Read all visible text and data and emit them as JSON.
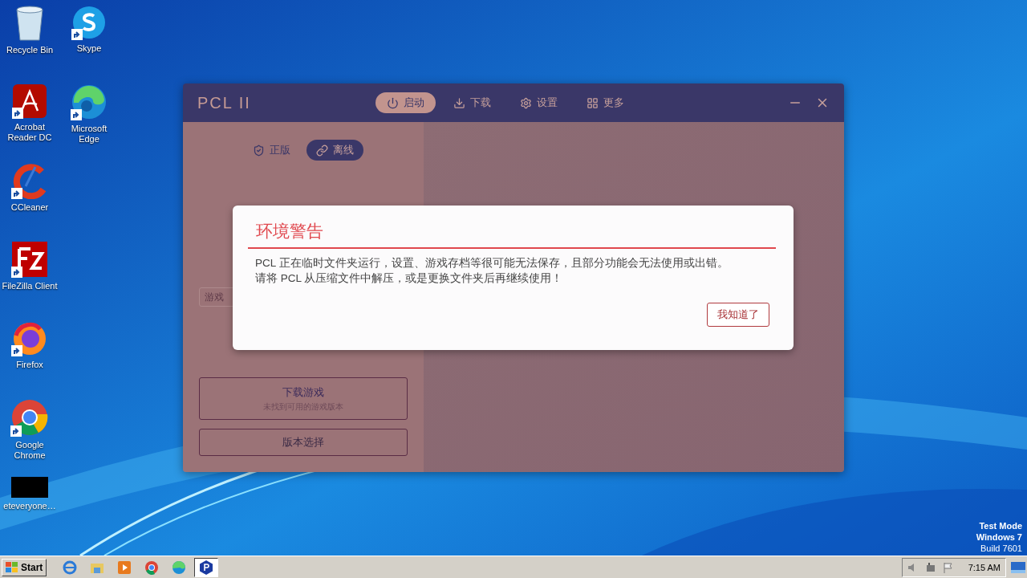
{
  "desktop_icons": [
    {
      "label": "Recycle Bin",
      "kind": "recycle",
      "shortcut": false
    },
    {
      "label": "Skype",
      "kind": "skype",
      "shortcut": true
    },
    {
      "label": "Acrobat Reader DC",
      "kind": "acrobat",
      "shortcut": true
    },
    {
      "label": "Microsoft Edge",
      "kind": "edge",
      "shortcut": true
    },
    {
      "label": "CCleaner",
      "kind": "ccleaner",
      "shortcut": true
    },
    {
      "label": "FileZilla Client",
      "kind": "filezilla",
      "shortcut": true
    },
    {
      "label": "Firefox",
      "kind": "firefox",
      "shortcut": true
    },
    {
      "label": "Google Chrome",
      "kind": "chrome",
      "shortcut": true
    },
    {
      "label": "eteveryone…",
      "kind": "blank",
      "shortcut": false
    }
  ],
  "window": {
    "title": "PCL II",
    "nav": [
      {
        "label": "启动",
        "kind": "power",
        "selected": true
      },
      {
        "label": "下载",
        "kind": "download",
        "selected": false
      },
      {
        "label": "设置",
        "kind": "settings",
        "selected": false
      },
      {
        "label": "更多",
        "kind": "grid",
        "selected": false
      }
    ],
    "login_tabs": [
      {
        "label": "正版",
        "kind": "shield",
        "selected": false
      },
      {
        "label": "离线",
        "kind": "link",
        "selected": true
      }
    ],
    "name_field": {
      "placeholder": "游戏"
    },
    "download_button": {
      "label": "下载游戏",
      "subtitle": "未找到可用的游戏版本"
    },
    "version_button": {
      "label": "版本选择"
    }
  },
  "dialog": {
    "title": "环境警告",
    "message": [
      "PCL 正在临时文件夹运行，设置、游戏存档等很可能无法保存，且部分功能会无法使用或出错。",
      "请将 PCL 从压缩文件中解压，或是更换文件夹后再继续使用！"
    ],
    "button": "我知道了"
  },
  "os_notice": [
    "Test Mode",
    "Windows 7",
    "Build 7601"
  ],
  "taskbar": {
    "start": "Start",
    "apps": [
      {
        "kind": "ie",
        "selected": false
      },
      {
        "kind": "explorer",
        "selected": false
      },
      {
        "kind": "media",
        "selected": false
      },
      {
        "kind": "chrome",
        "selected": false
      },
      {
        "kind": "edge",
        "selected": false
      },
      {
        "kind": "pcl",
        "selected": true
      }
    ],
    "clock": "7:15 AM"
  }
}
